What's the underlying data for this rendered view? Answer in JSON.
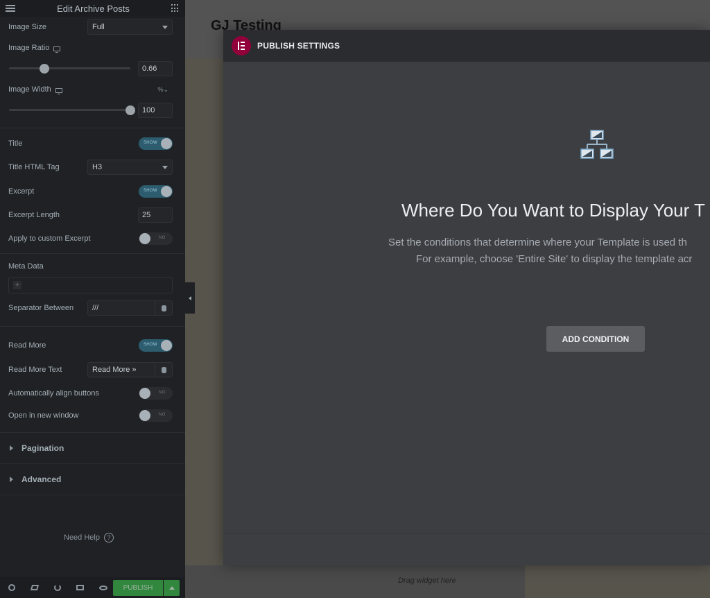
{
  "panel": {
    "title": "Edit Archive Posts",
    "fields": {
      "image_size": {
        "label": "Image Size",
        "value": "Full"
      },
      "image_ratio": {
        "label": "Image Ratio",
        "value": "0.66"
      },
      "image_width": {
        "label": "Image Width",
        "value": "100",
        "unit": "%"
      },
      "title": {
        "label": "Title",
        "toggle": "SHOW"
      },
      "title_tag": {
        "label": "Title HTML Tag",
        "value": "H3"
      },
      "excerpt": {
        "label": "Excerpt",
        "toggle": "SHOW"
      },
      "excerpt_length": {
        "label": "Excerpt Length",
        "value": "25"
      },
      "custom_excerpt": {
        "label": "Apply to custom Excerpt",
        "toggle": "NO"
      },
      "meta_data": {
        "label": "Meta Data"
      },
      "separator": {
        "label": "Separator Between",
        "value": "///"
      },
      "read_more": {
        "label": "Read More",
        "toggle": "SHOW"
      },
      "read_more_text": {
        "label": "Read More Text",
        "value": "Read More »"
      },
      "align_buttons": {
        "label": "Automatically align buttons",
        "toggle": "NO"
      },
      "new_window": {
        "label": "Open in new window",
        "toggle": "NO"
      }
    },
    "sections": {
      "pagination": "Pagination",
      "advanced": "Advanced"
    },
    "need_help": "Need Help",
    "help_glyph": "?",
    "publish_label": "PUBLISH"
  },
  "preview": {
    "site_title": "GJ Testing",
    "drag_text": "Drag widget here"
  },
  "modal": {
    "title": "PUBLISH SETTINGS",
    "heading": "Where Do You Want to Display Your T",
    "description_line1": "Set the conditions that determine where your Template is used th",
    "description_line2": "For example, choose 'Entire Site' to display the template acr",
    "add_condition": "ADD CONDITION"
  },
  "colors": {
    "publish_green": "#39b54a",
    "elementor_brand": "#92003b"
  },
  "levels": {
    "image_ratio_slider": 0.29,
    "image_width_slider": 1.0
  }
}
